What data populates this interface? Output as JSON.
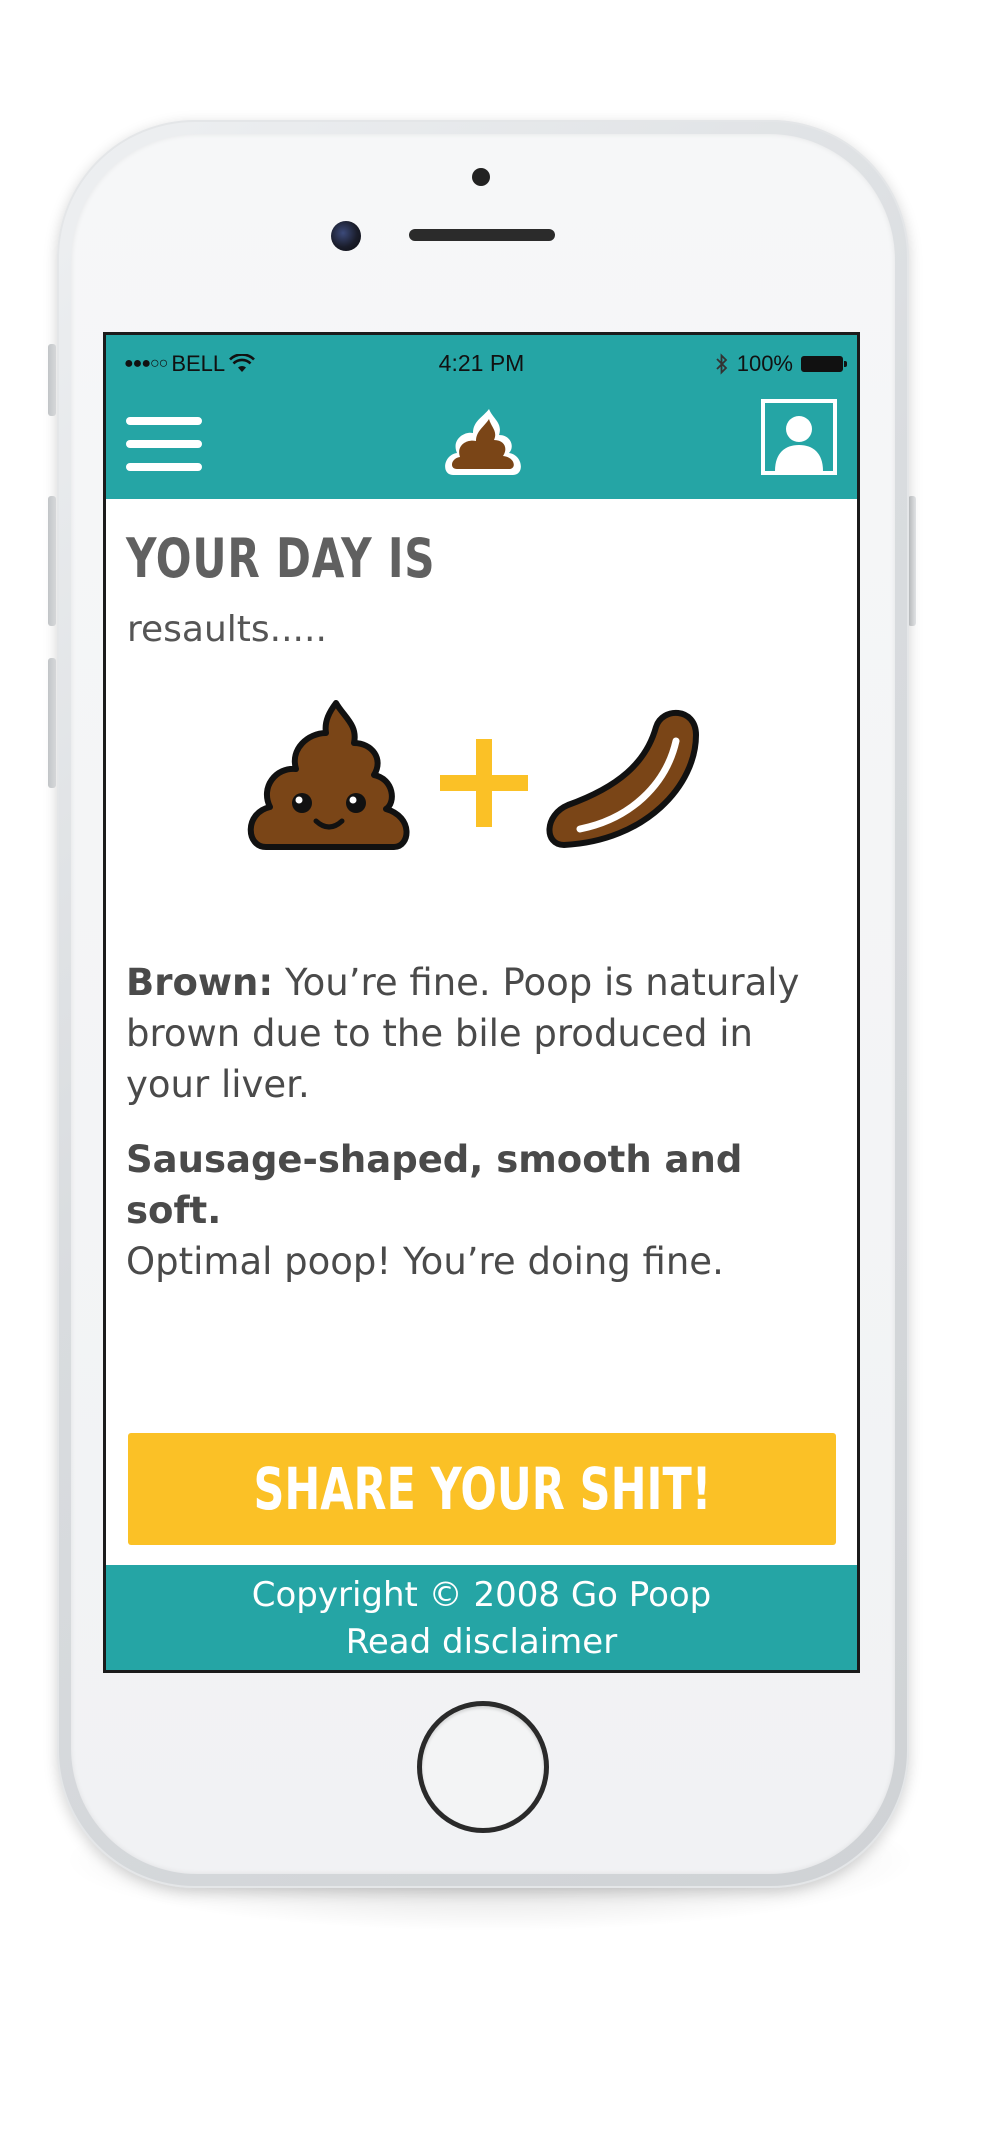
{
  "status_bar": {
    "carrier": "BELL",
    "time": "4:21 PM",
    "battery": "100%",
    "signal_dots": "●●●○○",
    "icons": [
      "wifi-icon",
      "bluetooth-icon",
      "battery-icon"
    ]
  },
  "nav": {
    "menu_icon": "hamburger-menu-icon",
    "logo_icon": "poop-logo-icon",
    "profile_icon": "user-profile-icon"
  },
  "main": {
    "title": "YOUR DAY IS",
    "subtitle": "resaults.....",
    "result_icons": [
      "smiling-poop-icon",
      "plus-icon",
      "sausage-poop-icon"
    ],
    "color_result": {
      "label": "Brown:",
      "text": " You’re fine. Poop is naturaly brown due to the bile produced in your liver."
    },
    "shape_result": {
      "label": "Sausage-shaped, smooth and soft.",
      "text": "Optimal poop! You’re doing fine."
    },
    "share_button": "SHARE YOUR SHIT!"
  },
  "footer": {
    "copyright": "Copyright © 2008 Go Poop",
    "disclaimer_link": "Read disclaimer"
  },
  "colors": {
    "teal": "#25a5a5",
    "yellow": "#fbc126",
    "brown": "#7a4517",
    "text_gray": "#4a4a4a"
  }
}
